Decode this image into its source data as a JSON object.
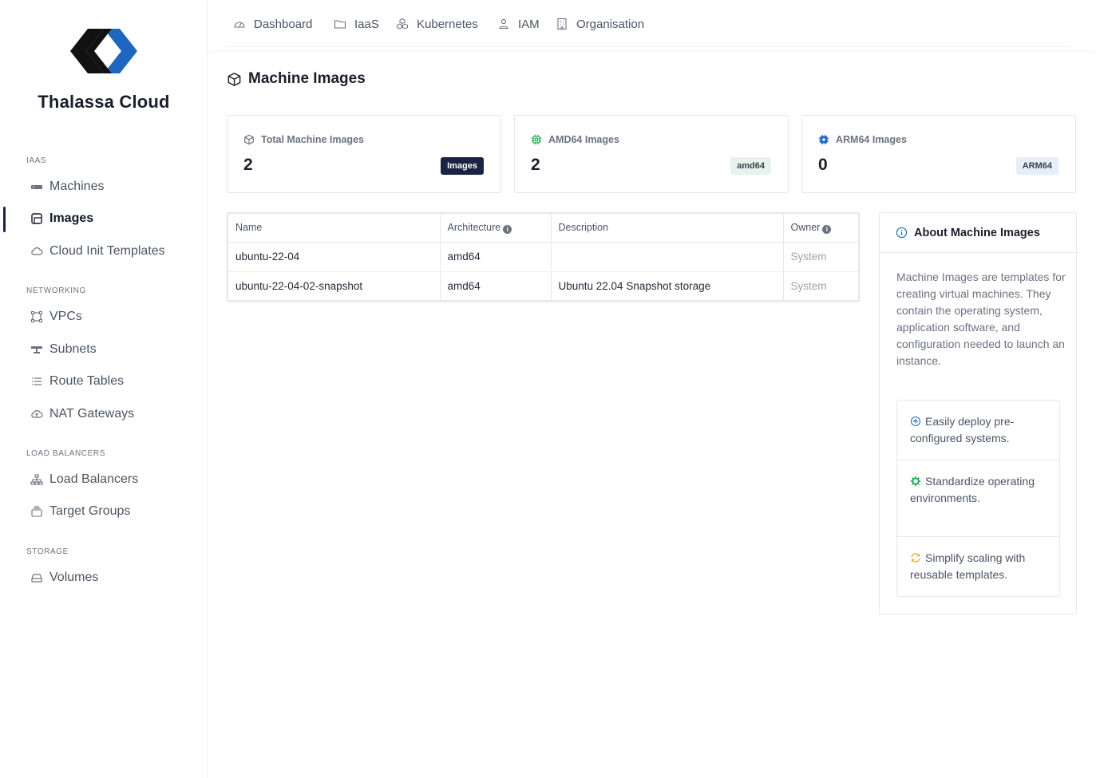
{
  "brand": {
    "name": "Thalassa Cloud",
    "colors": {
      "dark": "#111111",
      "accent": "#1f66c1"
    }
  },
  "sidebar": {
    "sections": [
      {
        "title": "IAAS",
        "items": [
          {
            "label": "Machines",
            "icon": "server-icon"
          },
          {
            "label": "Images",
            "icon": "image-icon",
            "active": true
          },
          {
            "label": "Cloud Init Templates",
            "icon": "cloud-icon"
          }
        ]
      },
      {
        "title": "NETWORKING",
        "items": [
          {
            "label": "VPCs",
            "icon": "vpc-icon"
          },
          {
            "label": "Subnets",
            "icon": "subnet-icon"
          },
          {
            "label": "Route Tables",
            "icon": "list-icon"
          },
          {
            "label": "NAT Gateways",
            "icon": "cloud-upload-icon"
          }
        ]
      },
      {
        "title": "LOAD BALANCERS",
        "items": [
          {
            "label": "Load Balancers",
            "icon": "network-icon"
          },
          {
            "label": "Target Groups",
            "icon": "stack-icon"
          }
        ]
      },
      {
        "title": "STORAGE",
        "items": [
          {
            "label": "Volumes",
            "icon": "drive-icon"
          }
        ]
      }
    ]
  },
  "topnav": {
    "items": [
      {
        "label": "Dashboard",
        "icon": "gauge-icon"
      },
      {
        "label": "IaaS",
        "icon": "folder-icon"
      },
      {
        "label": "Kubernetes",
        "icon": "cubes-icon"
      },
      {
        "label": "IAM",
        "icon": "user-icon"
      },
      {
        "label": "Organisation",
        "icon": "building-icon"
      }
    ]
  },
  "page": {
    "title": "Machine Images"
  },
  "stats": [
    {
      "label": "Total Machine Images",
      "value": "2",
      "badge": "Images",
      "icon": "box-icon"
    },
    {
      "label": "AMD64 Images",
      "value": "2",
      "badge": "amd64",
      "icon": "chip-green-icon"
    },
    {
      "label": "ARM64 Images",
      "value": "0",
      "badge": "ARM64",
      "icon": "chip-blue-icon"
    }
  ],
  "table": {
    "headers": {
      "name": "Name",
      "architecture": "Architecture",
      "description": "Description",
      "owner": "Owner"
    },
    "info_glyph": "i",
    "rows": [
      {
        "name": "ubuntu-22-04",
        "architecture": "amd64",
        "description": "",
        "owner": "System"
      },
      {
        "name": "ubuntu-22-04-02-snapshot",
        "architecture": "amd64",
        "description": "Ubuntu 22.04 Snapshot storage",
        "owner": "System"
      }
    ]
  },
  "about": {
    "title": "About Machine Images",
    "description": "Machine Images are templates for creating virtual machines. They contain the operating system, application software, and configuration needed to launch an instance.",
    "features": [
      {
        "text": "Easily deploy pre-configured systems.",
        "icon": "deploy-icon",
        "color": "#1f66c1"
      },
      {
        "text": "Standardize operating environments.",
        "icon": "gear-icon",
        "color": "#16a34a"
      },
      {
        "text": "Simplify scaling with reusable templates.",
        "icon": "refresh-icon",
        "color": "#f59e0b"
      }
    ]
  }
}
